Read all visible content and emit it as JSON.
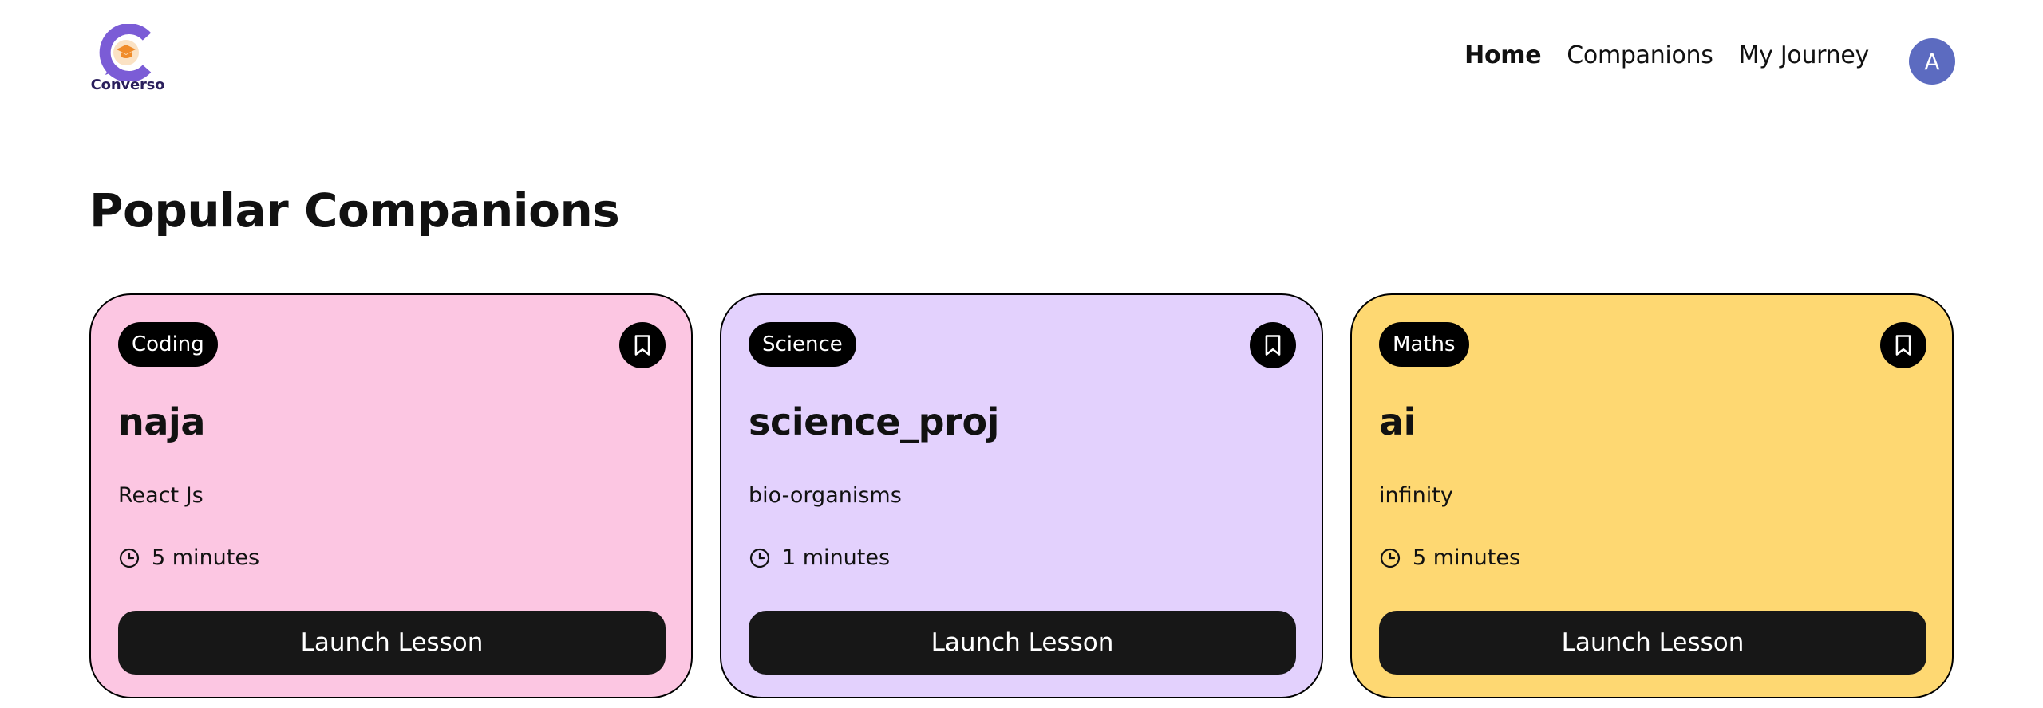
{
  "colors": {
    "coding": "#fcc6e2",
    "science": "#e3d1fd",
    "maths": "#fed872",
    "avatar": "#5c6bc0",
    "logo_purple": "#7b5cd6",
    "logo_orange": "#f08c2a"
  },
  "brand": {
    "name": "Converso",
    "logo_icon": "graduation-cap-chat-logo"
  },
  "nav": {
    "items": [
      {
        "label": "Home",
        "active": true
      },
      {
        "label": "Companions",
        "active": false
      },
      {
        "label": "My Journey",
        "active": false
      }
    ],
    "avatar_initial": "A"
  },
  "main": {
    "title": "Popular Companions",
    "cards": [
      {
        "subject": "Coding",
        "name": "naja",
        "topic": "React Js",
        "duration": "5 minutes",
        "button": "Launch Lesson",
        "bookmark_icon": "bookmark-icon",
        "color": "#fcc6e2"
      },
      {
        "subject": "Science",
        "name": "science_proj",
        "topic": "bio-organisms",
        "duration": "1 minutes",
        "button": "Launch Lesson",
        "bookmark_icon": "bookmark-icon",
        "color": "#e3d1fd"
      },
      {
        "subject": "Maths",
        "name": "ai",
        "topic": "infinity",
        "duration": "5 minutes",
        "button": "Launch Lesson",
        "bookmark_icon": "bookmark-icon",
        "color": "#fed872"
      }
    ]
  }
}
